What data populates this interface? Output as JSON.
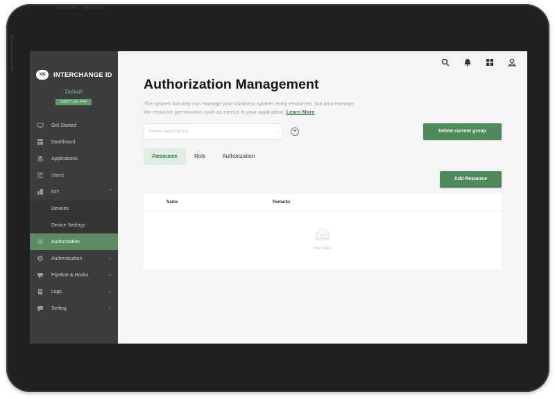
{
  "sidebar": {
    "logo_text": "XXI",
    "brand_name": "INTERCHANGE ID",
    "tenant": "Default",
    "user_pool_badge": "Switch User Pool",
    "items": [
      {
        "label": "Get Started",
        "icon": "rocket-icon"
      },
      {
        "label": "Dashboard",
        "icon": "dashboard-icon"
      },
      {
        "label": "Applications",
        "icon": "layers-icon"
      },
      {
        "label": "Users",
        "icon": "users-icon"
      },
      {
        "label": "IOT",
        "icon": "building-icon",
        "expanded": true
      },
      {
        "label": "Devices"
      },
      {
        "label": "Device Settings"
      },
      {
        "label": "Authorization",
        "icon": "shield-icon",
        "active": true
      },
      {
        "label": "Authentication",
        "icon": "gear-icon"
      },
      {
        "label": "Pipeline & Hooks",
        "icon": "pipeline-icon"
      },
      {
        "label": "Logs",
        "icon": "document-icon"
      },
      {
        "label": "Setting",
        "icon": "settings-icon"
      }
    ]
  },
  "topbar": {
    "icons": [
      "search-icon",
      "bell-icon",
      "apps-grid-icon",
      "user-icon"
    ]
  },
  "main": {
    "title": "Authorization Management",
    "description": "The system not only can manage your business system entity resources, but also manage the resource permissions such as menus in your application.",
    "learn_more": "Learn More",
    "group_select_placeholder": "Please select group",
    "delete_group_label": "Delete current group",
    "tabs": [
      {
        "label": "Resource",
        "active": true
      },
      {
        "label": "Role",
        "active": false
      },
      {
        "label": "Authorization",
        "active": false
      }
    ],
    "add_resource_label": "Add Resource",
    "table": {
      "columns": [
        "Name",
        "Remarks"
      ],
      "empty_text": "No Data"
    }
  },
  "colors": {
    "accent": "#4e8a5b",
    "sidebar_bg": "#3b3d3e",
    "active_item": "#5c8a63",
    "tab_active_bg": "#deeee0"
  }
}
